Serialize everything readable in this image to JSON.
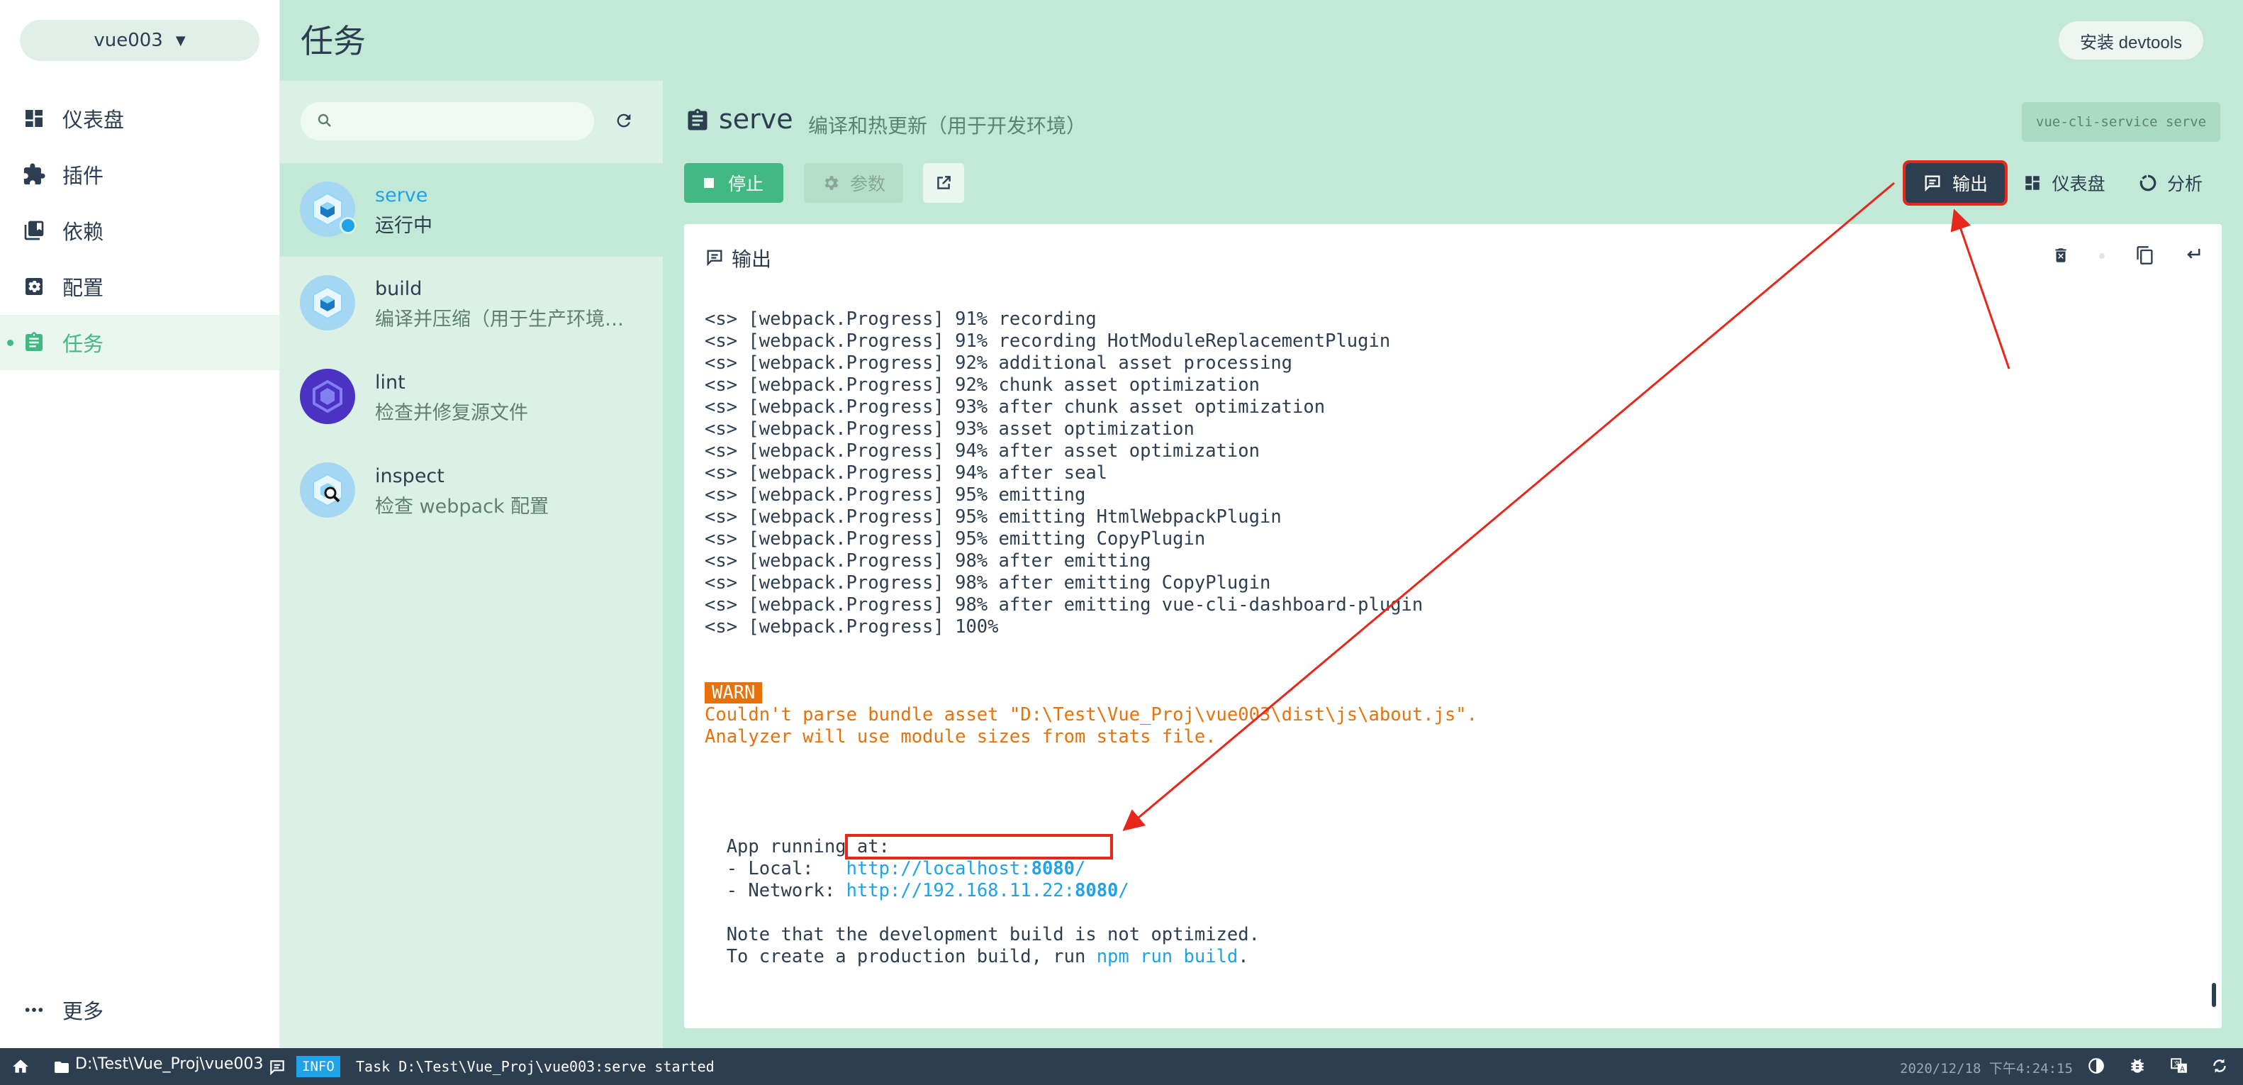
{
  "project": {
    "name": "vue003"
  },
  "nav": {
    "items": [
      {
        "id": "dashboard",
        "label": "仪表盘",
        "icon": "dashboard-icon"
      },
      {
        "id": "plugins",
        "label": "插件",
        "icon": "puzzle-icon"
      },
      {
        "id": "dependencies",
        "label": "依赖",
        "icon": "library-books-icon"
      },
      {
        "id": "config",
        "label": "配置",
        "icon": "settings-applications-icon"
      },
      {
        "id": "tasks",
        "label": "任务",
        "icon": "assignment-icon",
        "active": true
      }
    ],
    "more_label": "更多"
  },
  "header": {
    "title": "任务",
    "install_devtools": "安装 devtools"
  },
  "search": {
    "placeholder": ""
  },
  "tasks": [
    {
      "name": "serve",
      "description": "运行中",
      "active": true,
      "running": true
    },
    {
      "name": "build",
      "description": "编译并压缩（用于生产环境…"
    },
    {
      "name": "lint",
      "description": "检查并修复源文件"
    },
    {
      "name": "inspect",
      "description": "检查 webpack 配置"
    }
  ],
  "task_detail": {
    "name": "serve",
    "description": "编译和热更新（用于开发环境）",
    "command": "vue-cli-service serve",
    "stop_label": "停止",
    "params_label": "参数",
    "tabs": {
      "output": "输出",
      "dashboard": "仪表盘",
      "analysis": "分析"
    },
    "active_tab": "output"
  },
  "output": {
    "title": "输出",
    "progress_lines": [
      "<s> [webpack.Progress] 91% recording",
      "<s> [webpack.Progress] 91% recording HotModuleReplacementPlugin",
      "<s> [webpack.Progress] 92% additional asset processing",
      "<s> [webpack.Progress] 92% chunk asset optimization",
      "<s> [webpack.Progress] 93% after chunk asset optimization",
      "<s> [webpack.Progress] 93% asset optimization",
      "<s> [webpack.Progress] 94% after asset optimization",
      "<s> [webpack.Progress] 94% after seal",
      "<s> [webpack.Progress] 95% emitting",
      "<s> [webpack.Progress] 95% emitting HtmlWebpackPlugin",
      "<s> [webpack.Progress] 95% emitting CopyPlugin",
      "<s> [webpack.Progress] 98% after emitting",
      "<s> [webpack.Progress] 98% after emitting CopyPlugin",
      "<s> [webpack.Progress] 98% after emitting vue-cli-dashboard-plugin",
      "<s> [webpack.Progress] 100%"
    ],
    "warn_tag": "WARN",
    "warn_lines": [
      "Couldn't parse bundle asset \"D:\\Test\\Vue_Proj\\vue003\\dist\\js\\about.js\".",
      "Analyzer will use module sizes from stats file."
    ],
    "app_running": "  App running at:",
    "local_label": "  - Local:   ",
    "local_url_prefix": "http://localhost:",
    "local_port": "8080",
    "local_url_suffix": "/",
    "network_label": "  - Network: ",
    "network_url_prefix": "http://192.168.11.22:",
    "network_port": "8080",
    "network_url_suffix": "/",
    "note_line": "  Note that the development build is not optimized.",
    "prod_prefix": "  To create a production build, run ",
    "prod_command": "npm run build",
    "prod_suffix": "."
  },
  "statusbar": {
    "path": "D:\\Test\\Vue_Proj\\vue003",
    "level": "INFO",
    "message": "Task D:\\Test\\Vue_Proj\\vue003:serve started",
    "timestamp": "2020/12/18 下午4:24:15"
  },
  "colors": {
    "accent": "#42b983",
    "dark": "#2c3e50",
    "link": "#1fa3e8",
    "warn": "#e8710a",
    "annotation": "#e8261c"
  }
}
